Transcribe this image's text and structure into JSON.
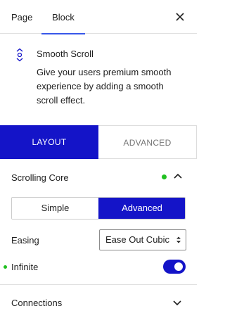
{
  "tabs": {
    "page": "Page",
    "block": "Block"
  },
  "block": {
    "icon": "smooth-scroll-icon",
    "title": "Smooth Scroll",
    "description": "Give your users premium smooth experience by adding a smooth scroll effect."
  },
  "panel_tabs": {
    "layout": "LAYOUT",
    "advanced": "ADVANCED"
  },
  "section": {
    "title": "Scrolling Core",
    "mode_options": [
      "Simple",
      "Advanced"
    ],
    "mode_selected": "Advanced",
    "easing_label": "Easing",
    "easing_value": "Ease Out Cubic",
    "infinite_label": "Infinite",
    "infinite_on": true
  },
  "connections": {
    "title": "Connections"
  },
  "colors": {
    "accent": "#1414c8",
    "indicator": "#20c020",
    "tab_underline": "#3858e9"
  }
}
